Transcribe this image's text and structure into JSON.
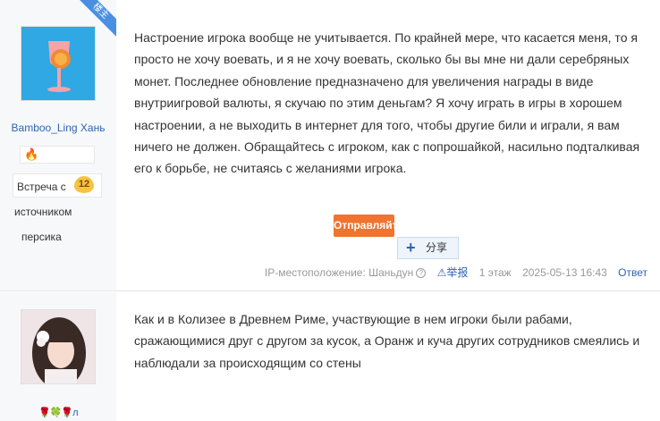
{
  "posts": [
    {
      "author": {
        "name": "Bamboo_Ling Хань",
        "corner_badge": "楼主",
        "badge_icon": "flame-icon",
        "level_label": "Встреча с",
        "level_number": "12",
        "extra_line1": "источником",
        "extra_line2": "персика"
      },
      "content": "Настроение игрока вообще не учитывается. По крайней мере, что касается меня, то я просто не хочу воевать, и я не хочу воевать, сколько бы вы мне ни дали серебряных монет. Последнее обновление предназначено для увеличения награды в виде внутриигровой валюты, я скучаю по этим деньгам? Я хочу играть в игры в хорошем настроении, а не выходить в интернет для того, чтобы другие били и играли, я вам ничего не должен. Обращайтесь с игроком, как с попрошайкой, насильно подталкивая его к борьбе, не считаясь с желаниями игрока.",
      "send_label": "Отправляйте",
      "share_label": "分享",
      "meta": {
        "ip": "IP-местоположение: Шаньдун",
        "report": "举报",
        "floor": "1 этаж",
        "datetime": "2025-05-13 16:43",
        "reply": "Ответ"
      }
    },
    {
      "author": {
        "deco_text": "л"
      },
      "content": "Как и в Колизее в Древнем Риме, участвующие в нем игроки были рабами, сражающимися друг с другом за кусок, а Оранж и куча других сотрудников смеялись и наблюдали за происходящим со стены"
    }
  ],
  "colors": {
    "accent": "#2d64b3",
    "send_button": "#f0732f",
    "sidebar_bg": "#f7f8fa"
  }
}
